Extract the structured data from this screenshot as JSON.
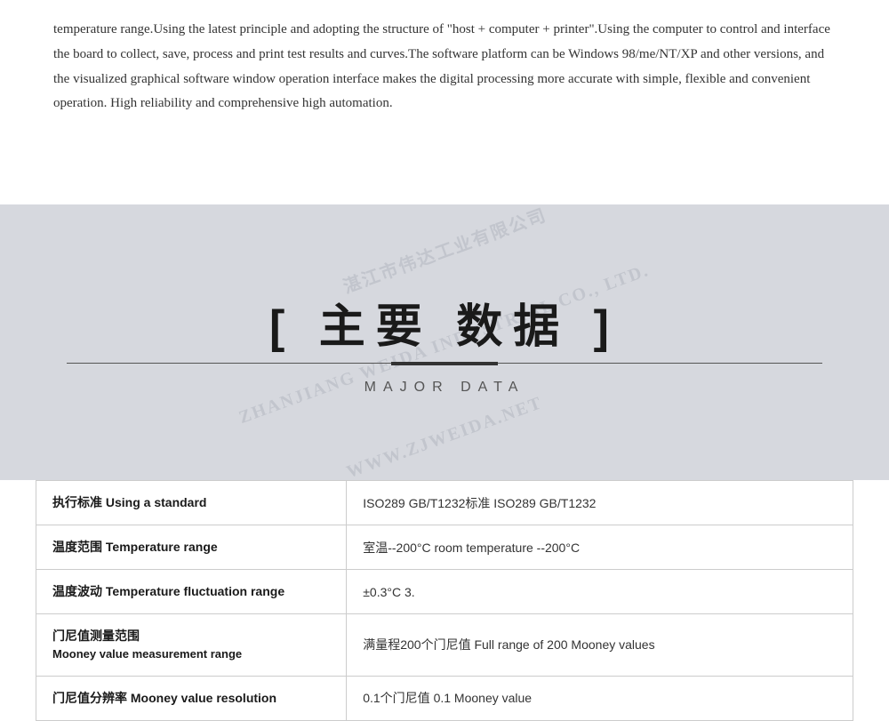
{
  "top": {
    "paragraph": "temperature range.Using the latest principle and adopting the structure of \"host + computer + printer\".Using the computer to control and interface the board to collect, save, process and print test results and curves.The software platform can be Windows 98/me/NT/XP and other versions, and the visualized graphical software window operation interface makes the digital processing more accurate with simple, flexible and convenient operation. High reliability and comprehensive high automation."
  },
  "middle": {
    "main_title": "[ 主要  数据 ]",
    "title_cn_left_bracket": "[ 主要",
    "title_cn_right": "数据 ]",
    "subtitle": "MAJOR DATA",
    "watermark_lines": [
      "湛江市伟达工业有限公司",
      "ZHANJIANG WEIDA INDUSTRIAL CO., LTD.",
      "WWW.ZJWEIDA.NET"
    ]
  },
  "table": {
    "rows": [
      {
        "label_cn": "执行标准  Using a standard",
        "label_en": "",
        "value": "ISO289 GB/T1232标准    ISO289 GB/T1232"
      },
      {
        "label_cn": "温度范围 Temperature range",
        "label_en": "",
        "value": "室温--200°C      room temperature --200°C"
      },
      {
        "label_cn": "温度波动 Temperature fluctuation range",
        "label_en": "",
        "value": "±0.3°C 3."
      },
      {
        "label_cn": "门尼值测量范围",
        "label_en": "Mooney value measurement range",
        "value": "满量程200个门尼值     Full range of 200 Mooney values"
      },
      {
        "label_cn": "门尼值分辨率 Mooney value resolution",
        "label_en": "",
        "value": "0.1个门尼值      0.1 Mooney value"
      }
    ]
  }
}
